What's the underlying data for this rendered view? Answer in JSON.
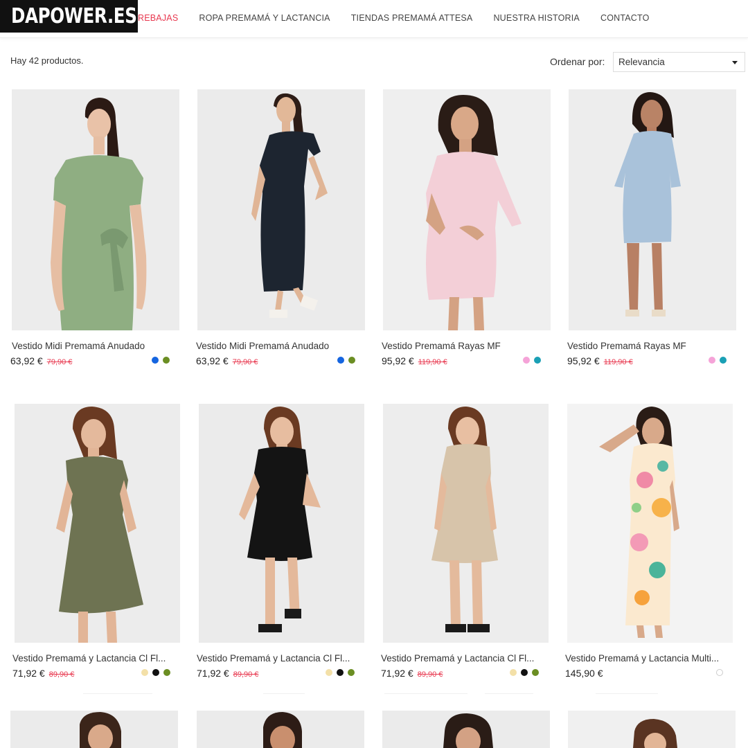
{
  "logo": {
    "text": "DAPOWER.ES"
  },
  "nav": {
    "items": [
      {
        "label": "REBAJAS",
        "active": true
      },
      {
        "label": "ROPA PREMAMÁ Y LACTANCIA"
      },
      {
        "label": "TIENDAS PREMAMÁ ATTESA"
      },
      {
        "label": "NUESTRA HISTORIA"
      },
      {
        "label": "CONTACTO"
      }
    ]
  },
  "listing": {
    "count_text": "Hay 42 productos.",
    "sort_label": "Ordenar por:",
    "sort_value": "Relevancia"
  },
  "colors": {
    "accent_red": "#e8384f",
    "swatch_blue": "#1565e0",
    "swatch_olive": "#6b8e23",
    "swatch_pink": "#f5a3d8",
    "swatch_teal": "#1aa0b5",
    "swatch_beige": "#f3e0a8",
    "swatch_black": "#111111",
    "swatch_white": "#ffffff"
  },
  "products": [
    {
      "name": "Vestido Midi Premamá Anudado",
      "price": "63,92 €",
      "old_price": "79,90 €",
      "swatches": [
        "blue",
        "olive"
      ],
      "image": "green dress"
    },
    {
      "name": "Vestido Midi Premamá Anudado",
      "price": "63,92 €",
      "old_price": "79,90 €",
      "swatches": [
        "blue",
        "olive"
      ],
      "image": "navy dress"
    },
    {
      "name": "Vestido Premamá Rayas MF",
      "price": "95,92 €",
      "old_price": "119,90 €",
      "swatches": [
        "pink",
        "teal"
      ],
      "image": "pink striped dress"
    },
    {
      "name": "Vestido Premamá Rayas MF",
      "price": "95,92 €",
      "old_price": "119,90 €",
      "swatches": [
        "pink",
        "teal"
      ],
      "image": "blue striped dress"
    },
    {
      "name": "Vestido Premamá y Lactancia Cl Fl...",
      "price": "71,92 €",
      "old_price": "89,90 €",
      "swatches": [
        "beige",
        "black",
        "olive"
      ],
      "image": "khaki dress"
    },
    {
      "name": "Vestido Premamá y Lactancia Cl Fl...",
      "price": "71,92 €",
      "old_price": "89,90 €",
      "swatches": [
        "beige",
        "black",
        "olive"
      ],
      "image": "black dress"
    },
    {
      "name": "Vestido Premamá y Lactancia Cl Fl...",
      "price": "71,92 €",
      "old_price": "89,90 €",
      "swatches": [
        "beige",
        "black",
        "olive"
      ],
      "image": "beige dress"
    },
    {
      "name": "Vestido Premamá y Lactancia Multi...",
      "price": "145,90 €",
      "old_price": "",
      "swatches": [
        "white"
      ],
      "image": "floral maxi dress"
    }
  ]
}
